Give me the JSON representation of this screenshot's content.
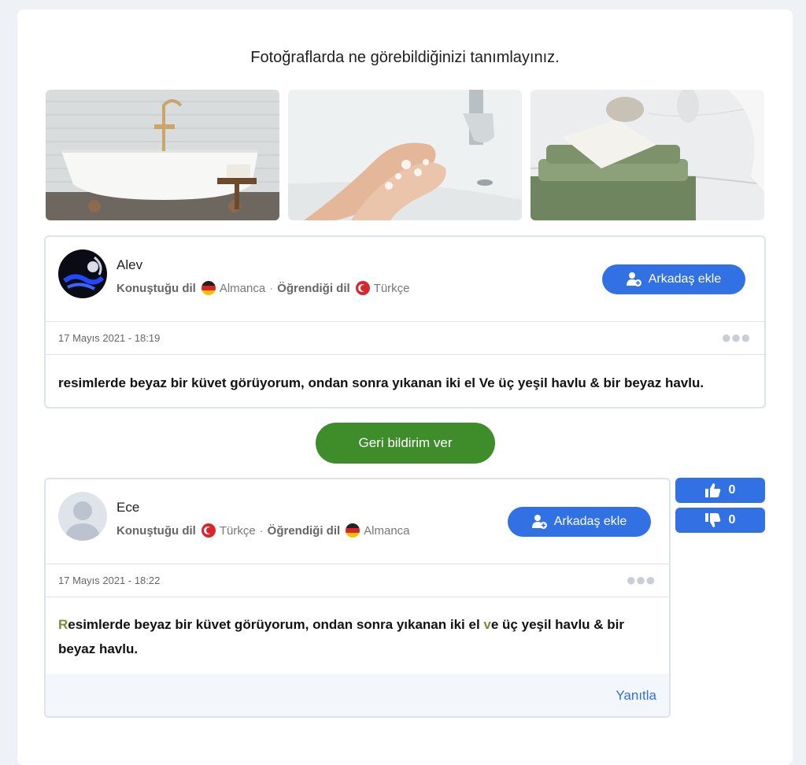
{
  "prompt": "Fotoğraflarda ne görebildiğinizi tanımlayınız.",
  "photos": [
    "bathtub-photo",
    "washing-hands-photo",
    "towels-photo"
  ],
  "posts": [
    {
      "username": "Alev",
      "speaks_label": "Konuştuğu dil",
      "speaks_lang": "Almanca",
      "learns_label": "Öğrendiği dil",
      "learns_lang": "Türkçe",
      "add_friend": "Arkadaş ekle",
      "timestamp": "17 Mayıs 2021 - 18:19",
      "text": "resimlerde beyaz bir küvet görüyorum, ondan sonra yıkanan iki el Ve üç yeşil havlu & bir beyaz havlu."
    },
    {
      "username": "Ece",
      "speaks_label": "Konuştuğu dil",
      "speaks_lang": "Türkçe",
      "learns_label": "Öğrendiği dil",
      "learns_lang": "Almanca",
      "add_friend": "Arkadaş ekle",
      "timestamp": "17 Mayıs 2021 - 18:22",
      "text_parts": [
        "R",
        "esimlerde beyaz bir küvet görüyorum, ondan sonra yıkanan iki el ",
        "v",
        "e üç yeşil havlu & bir",
        "beyaz havlu."
      ],
      "reply": "Yanıtla",
      "upvotes": "0",
      "downvotes": "0"
    }
  ],
  "feedback_button": "Geri bildirim ver",
  "colors": {
    "primary": "#3271e3",
    "feedback": "#3f8c2a",
    "correction": "#7d8a3c"
  }
}
